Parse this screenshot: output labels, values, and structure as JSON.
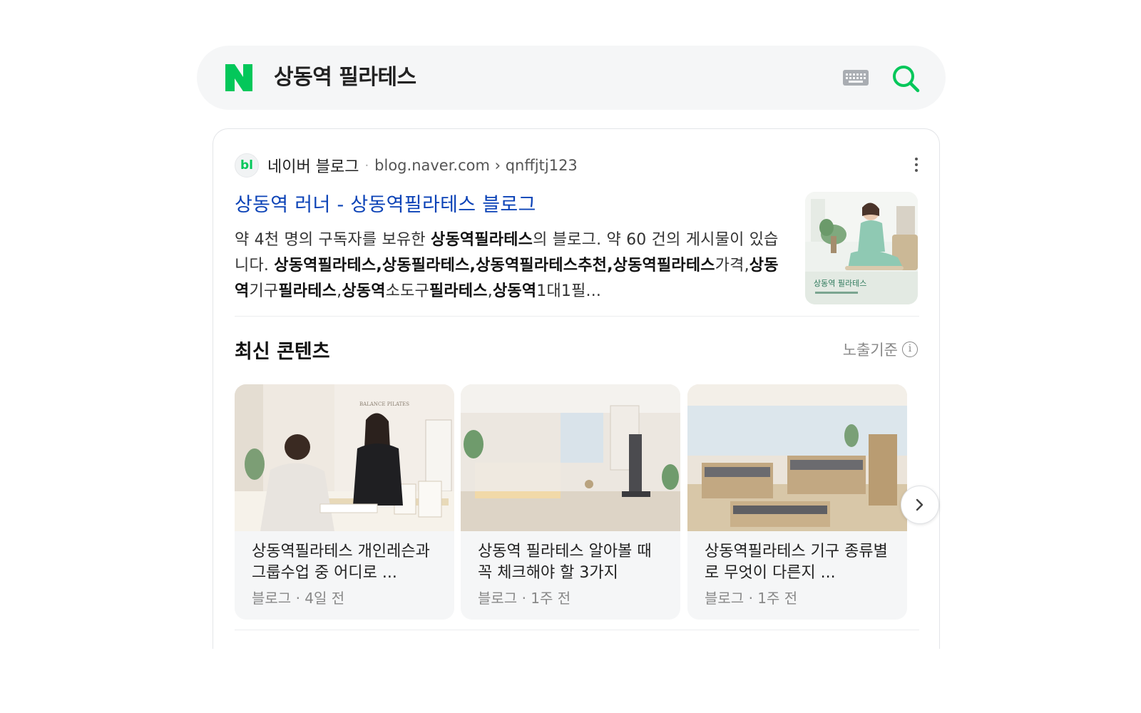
{
  "search": {
    "query": "상동역 필라테스",
    "logo_letter": "N",
    "brand_color": "#03c75a"
  },
  "result": {
    "badge": "bl",
    "source_name": "네이버 블로그",
    "separator": "·",
    "source_url": "blog.naver.com › qnffjtj123",
    "title": "상동역 러너 - 상동역필라테스 블로그",
    "description_parts": [
      {
        "text": "약 4천 명의 구독자를 보유한 ",
        "bold": false
      },
      {
        "text": "상동역필라테스",
        "bold": true
      },
      {
        "text": "의 블로그. 약 60 건의 게시물이 있습니다. ",
        "bold": false
      },
      {
        "text": "상동역필라테스,상동필라테스,상동역필라테스추천,상동역필라테스",
        "bold": true
      },
      {
        "text": "가격,",
        "bold": false
      },
      {
        "text": "상동역",
        "bold": true
      },
      {
        "text": "기구",
        "bold": false
      },
      {
        "text": "필라테스",
        "bold": true
      },
      {
        "text": ",",
        "bold": false
      },
      {
        "text": "상동역",
        "bold": true
      },
      {
        "text": "소도구",
        "bold": false
      },
      {
        "text": "필라테스",
        "bold": true
      },
      {
        "text": ",",
        "bold": false
      },
      {
        "text": "상동역",
        "bold": true
      },
      {
        "text": "1대1필...",
        "bold": false
      }
    ],
    "thumb_caption": "상동역 필라테스"
  },
  "latest": {
    "title": "최신 콘텐츠",
    "criteria": "노출기준",
    "info_glyph": "i",
    "items": [
      {
        "title": "상동역필라테스 개인레슨과 그룹수업 중 어디로 ...",
        "source": "블로그",
        "dot": "·",
        "time": "4일 전"
      },
      {
        "title": "상동역 필라테스 알아볼 때 꼭 체크해야 할 3가지",
        "source": "블로그",
        "dot": "·",
        "time": "1주 전"
      },
      {
        "title": "상동역필라테스 기구 종류별로 무엇이 다른지 ...",
        "source": "블로그",
        "dot": "·",
        "time": "1주 전"
      }
    ],
    "card1_sign": "BALANCE PILATES"
  },
  "icons": {
    "keyboard": "keyboard-icon",
    "search": "search-icon",
    "more": "more-vertical-icon",
    "info": "info-icon",
    "next": "chevron-right-icon"
  }
}
